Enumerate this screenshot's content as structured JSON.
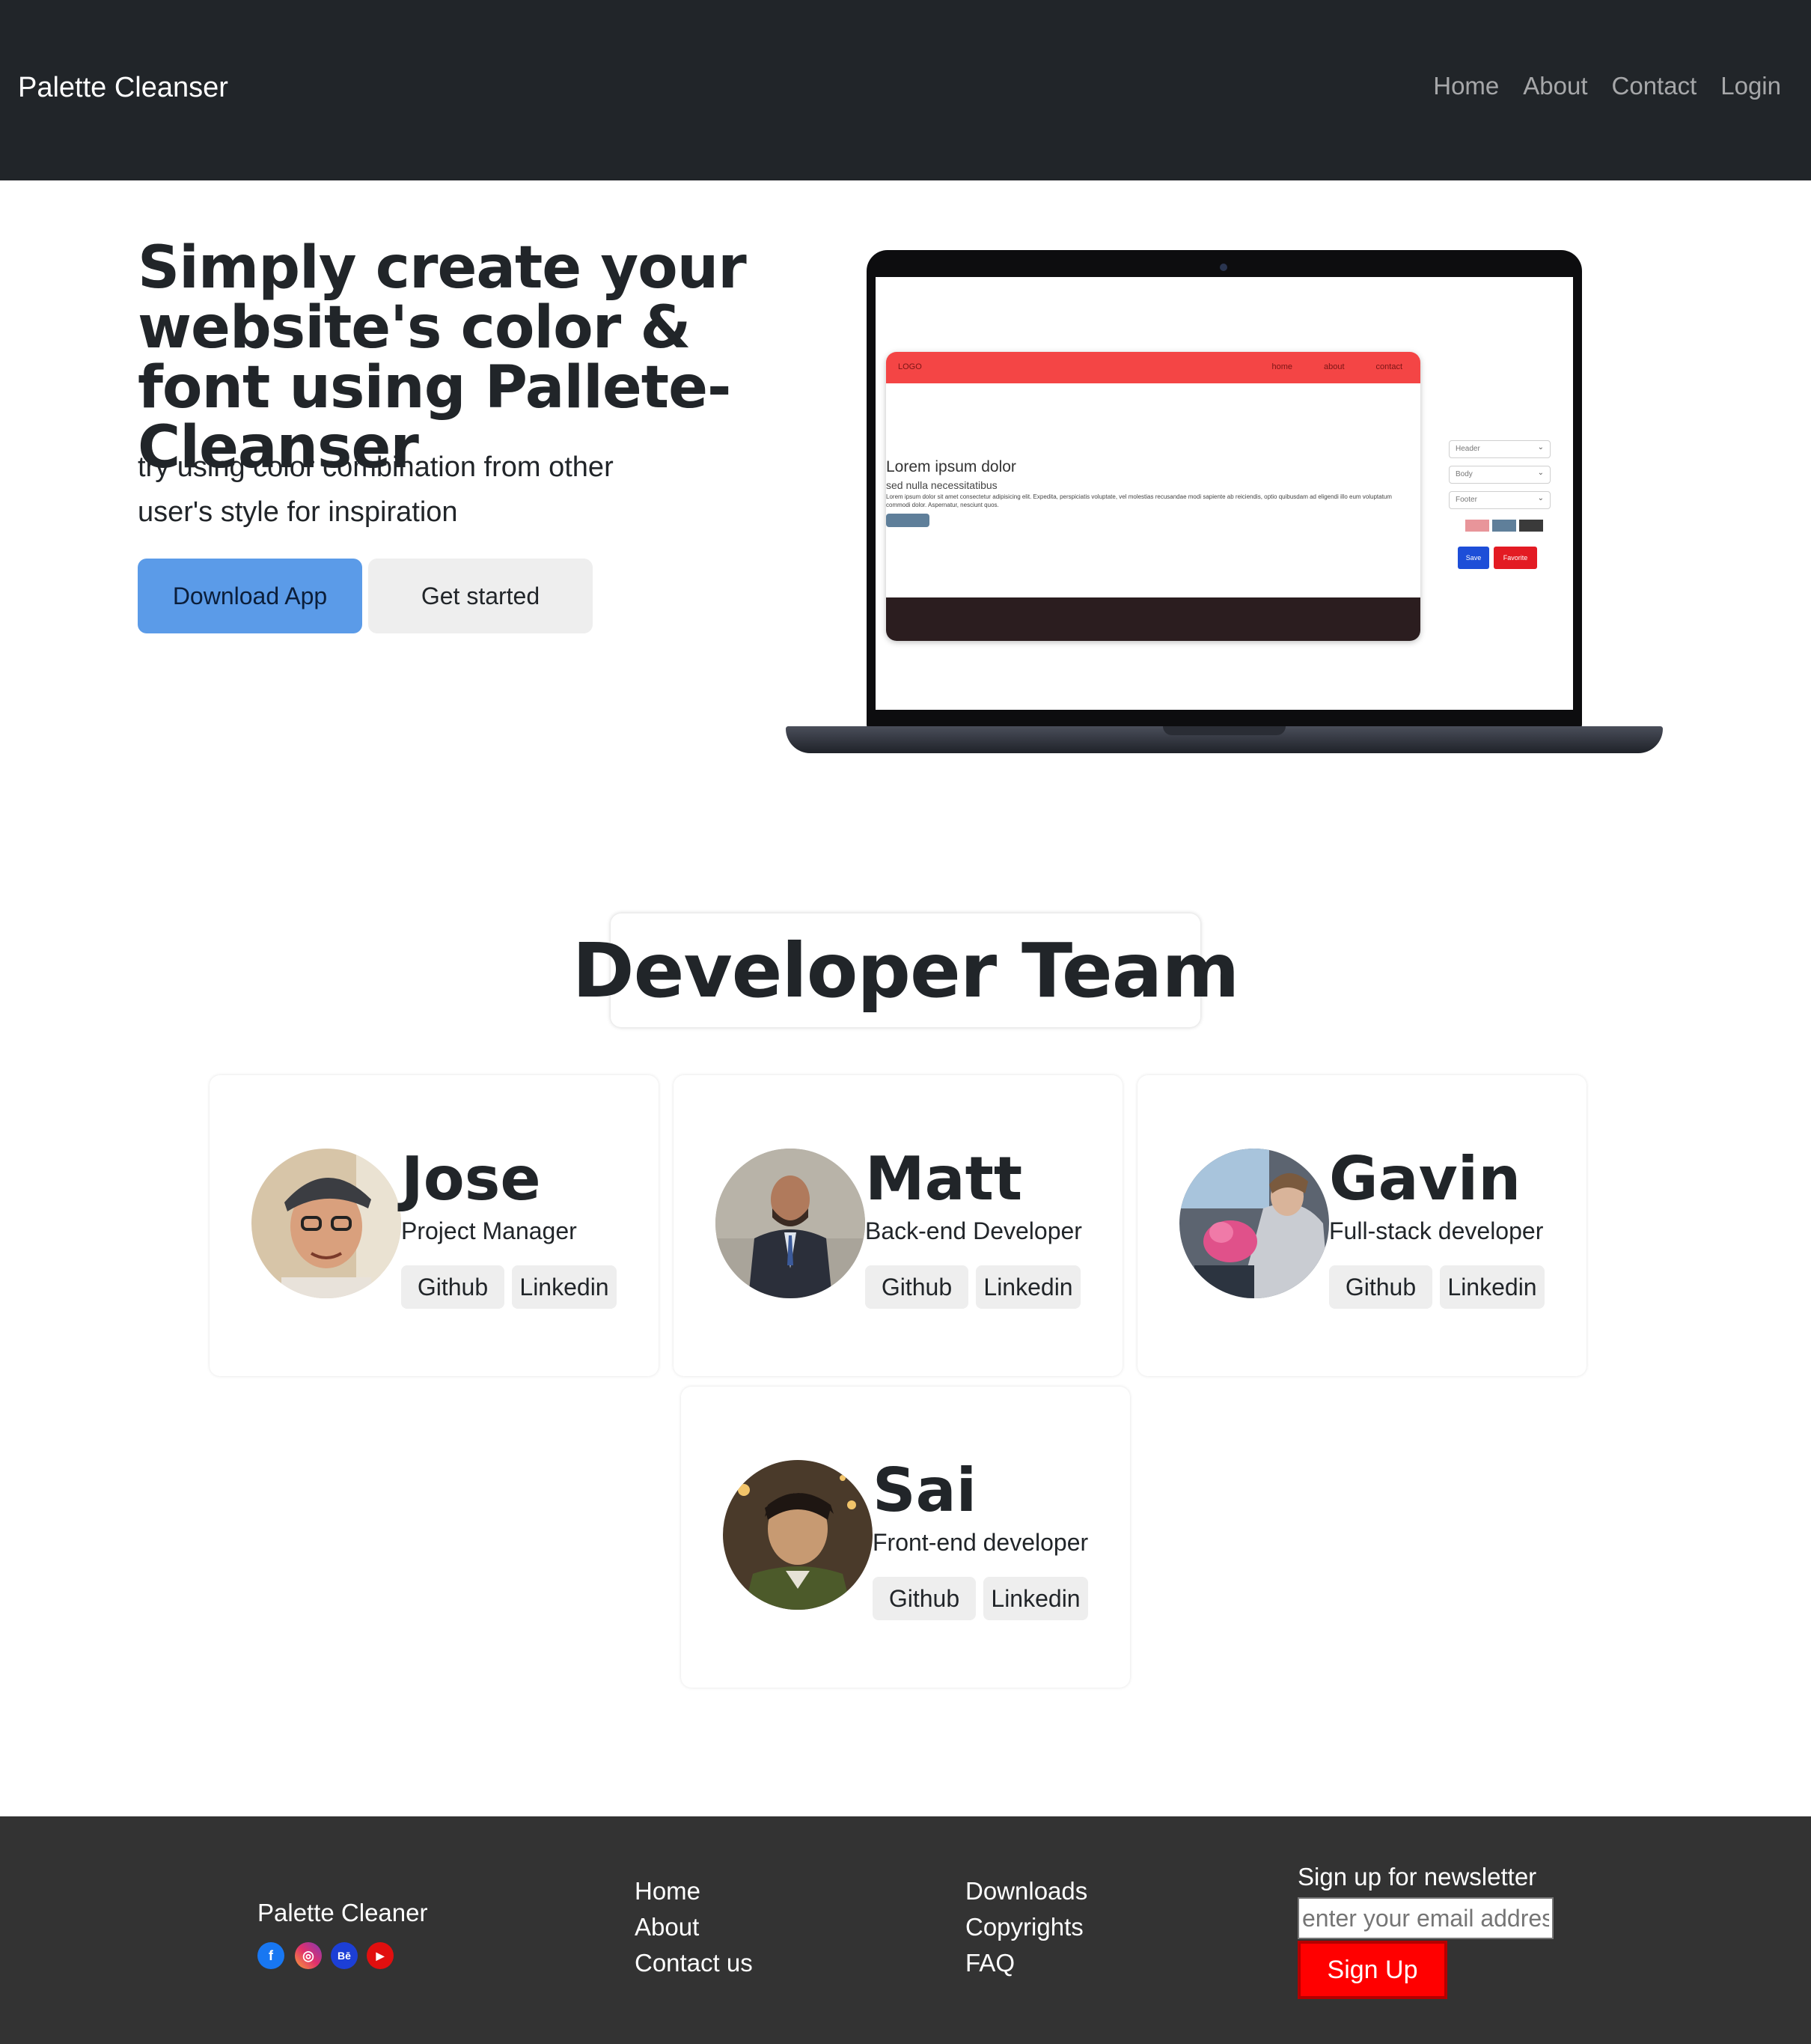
{
  "navbar": {
    "brand": "Palette Cleanser",
    "links": [
      "Home",
      "About",
      "Contact",
      "Login"
    ]
  },
  "hero": {
    "title": "Simply create your website's color & font using Pallete-Cleanser",
    "subtitle": "try using color combination from other user's style for inspiration",
    "download_label": "Download App",
    "get_started_label": "Get started"
  },
  "mockup": {
    "logo": "LOGO",
    "nav": [
      "home",
      "about",
      "contact"
    ],
    "heading": "Lorem ipsum dolor",
    "subheading": "sed nulla necessitatibus",
    "paragraph": "Lorem ipsum dolor sit amet consectetur adipisicing elit. Expedita, perspiciatis voluptate, vel molestias recusandae modi sapiente ab reiciendis, optio quibusdam ad eligendi illo eum voluptatum commodi dolor. Aspernatur, nesciunt quos.",
    "selects": [
      "Header",
      "Body",
      "Footer"
    ],
    "swatches": [
      "#e8959a",
      "#5f7f9a",
      "#3a3a3a"
    ],
    "save_label": "Save",
    "favorite_label": "Favorite"
  },
  "team": {
    "heading": "Developer Team",
    "members": [
      {
        "name": "Jose",
        "role": "Project Manager",
        "github": "Github",
        "linkedin": "Linkedin"
      },
      {
        "name": "Matt",
        "role": "Back-end Developer",
        "github": "Github",
        "linkedin": "Linkedin"
      },
      {
        "name": "Gavin",
        "role": "Full-stack developer",
        "github": "Github",
        "linkedin": "Linkedin"
      },
      {
        "name": "Sai",
        "role": "Front-end developer",
        "github": "Github",
        "linkedin": "Linkedin"
      }
    ]
  },
  "footer": {
    "brand": "Palette Cleaner",
    "social_icons": [
      "facebook-icon",
      "instagram-icon",
      "behance-icon",
      "youtube-icon"
    ],
    "col1": [
      "Home",
      "About",
      "Contact us"
    ],
    "col2": [
      "Downloads",
      "Copyrights",
      "FAQ"
    ],
    "newsletter_title": "Sign up for newsletter",
    "email_placeholder": "enter your email address",
    "signup_label": "Sign Up"
  },
  "colors": {
    "navbar_bg": "#212529",
    "primary_button": "#5b9be8",
    "footer_bg": "#333333",
    "signup_button": "#ff0000",
    "mock_header": "#f44545",
    "mock_footer": "#2b1d1f"
  }
}
